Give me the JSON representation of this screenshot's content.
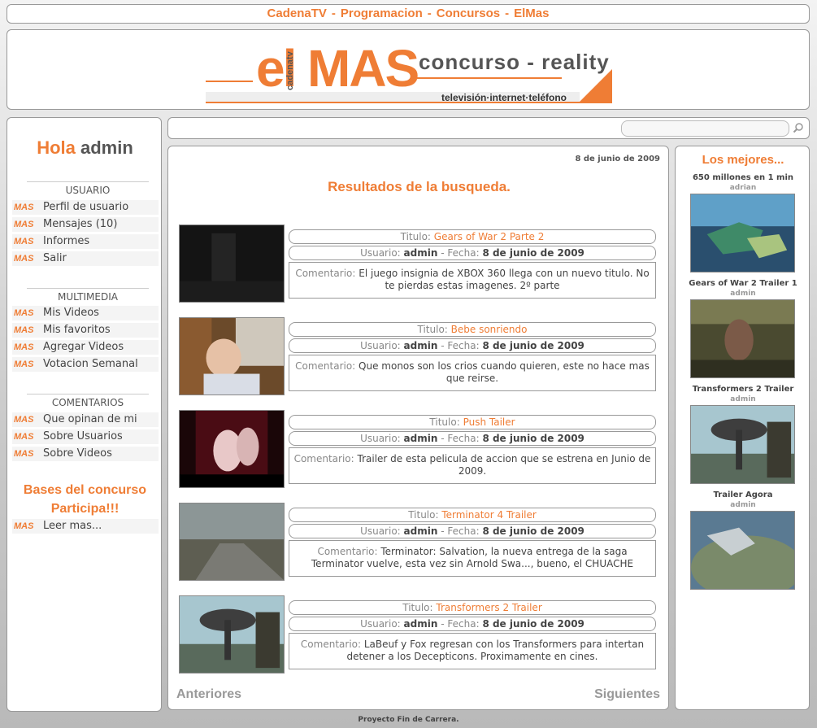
{
  "topbar": {
    "items": [
      "CadenaTV",
      "Programacion",
      "Concursos",
      "ElMas"
    ],
    "sep": "-"
  },
  "banner": {
    "logo_el": "el",
    "logo_mas": "MAS",
    "logo_cadena": "cadenatv",
    "logo_tagline": "concurso - reality",
    "logo_channels": "televisión·internet·teléfono"
  },
  "sidebar": {
    "hola": "Hola",
    "user": "admin",
    "tag": "MAS",
    "sections": [
      {
        "title": "USUARIO",
        "items": [
          "Perfil de usuario",
          "Mensajes (10)",
          "Informes",
          "Salir"
        ]
      },
      {
        "title": "MULTIMEDIA",
        "items": [
          "Mis Videos",
          "Mis favoritos",
          "Agregar Videos",
          "Votacion Semanal"
        ]
      },
      {
        "title": "COMENTARIOS",
        "items": [
          "Que opinan de mi",
          "Sobre Usuarios",
          "Sobre Videos"
        ]
      }
    ],
    "bases_line1": "Bases del concurso",
    "bases_line2": "Participa!!!",
    "leer": "Leer mas..."
  },
  "search": {
    "placeholder": "",
    "value": ""
  },
  "main": {
    "date": "8 de junio de 2009",
    "title": "Resultados de la busqueda.",
    "labels": {
      "titulo": "Titulo:",
      "usuario": "Usuario:",
      "fecha": "- Fecha:",
      "comentario": "Comentario:"
    },
    "results": [
      {
        "title": "Gears of War 2 Parte 2",
        "user": "admin",
        "date": "8 de junio de 2009",
        "comment": "El juego insignia de XBOX 360 llega con un nuevo titulo. No te pierdas estas imagenes. 2º parte",
        "thumb": "dark-game"
      },
      {
        "title": "Bebe sonriendo",
        "user": "admin",
        "date": "8 de junio de 2009",
        "comment": "Que monos son los crios cuando quieren, este no hace mas que reirse.",
        "thumb": "baby"
      },
      {
        "title": "Push Tailer",
        "user": "admin",
        "date": "8 de junio de 2009",
        "comment": "Trailer de esta pelicula de accion que se estrena en Junio de 2009.",
        "thumb": "hands"
      },
      {
        "title": "Terminator 4 Trailer",
        "user": "admin",
        "date": "8 de junio de 2009",
        "comment": "Terminator: Salvation, la nueva entrega de la saga Terminator vuelve, esta vez sin Arnold Swa..., bueno, el CHUACHE",
        "thumb": "road"
      },
      {
        "title": "Transformers 2 Trailer",
        "user": "admin",
        "date": "8 de junio de 2009",
        "comment": "LaBeuf y Fox regresan con los Transformers para intertan detener a los Decepticons. Proximamente en cines.",
        "thumb": "dish"
      }
    ],
    "prev": "Anteriores",
    "next": "Siguientes"
  },
  "right": {
    "title": "Los mejores...",
    "items": [
      {
        "title": "650 millones en 1 min",
        "user": "adrian",
        "thumb": "map"
      },
      {
        "title": "Gears of War 2 Trailer 1",
        "user": "admin",
        "thumb": "blurry"
      },
      {
        "title": "Transformers 2 Trailer",
        "user": "admin",
        "thumb": "dish"
      },
      {
        "title": "Trailer Agora",
        "user": "admin",
        "thumb": "earth"
      }
    ]
  },
  "footer": "Proyecto Fin de Carrera.",
  "colors": {
    "accent": "#ef7d35",
    "text": "#444444",
    "muted": "#888888"
  }
}
